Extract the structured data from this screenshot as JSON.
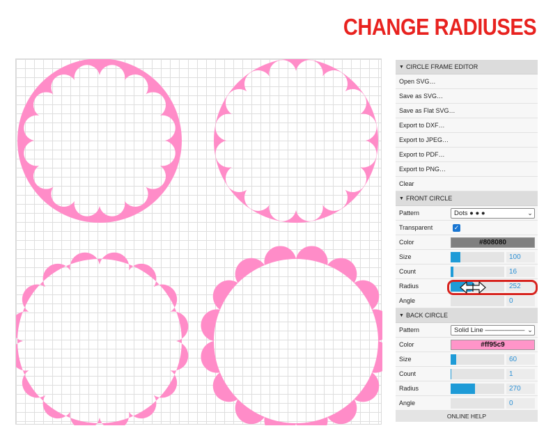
{
  "headline": "CHANGE RADIUSES",
  "editor": {
    "title": "CIRCLE FRAME EDITOR",
    "items": [
      "Open SVG…",
      "Save as SVG…",
      "Save as Flat SVG…",
      "Export to DXF…",
      "Export to JPEG…",
      "Export to PDF…",
      "Export to PNG…",
      "Clear"
    ]
  },
  "front": {
    "title": "FRONT CIRCLE",
    "pattern_label": "Pattern",
    "pattern_value": "Dots  ●  ●  ●",
    "transparent_label": "Transparent",
    "transparent_checked": true,
    "color_label": "Color",
    "color_value": "#808080",
    "size_label": "Size",
    "size_value": "100",
    "size_fill": 0.18,
    "count_label": "Count",
    "count_value": "16",
    "count_fill": 0.05,
    "radius_label": "Radius",
    "radius_value": "252",
    "radius_fill": 0.45,
    "angle_label": "Angle",
    "angle_value": "0",
    "angle_fill": 0
  },
  "back": {
    "title": "BACK CIRCLE",
    "pattern_label": "Pattern",
    "pattern_value": "Solid Line  ——————",
    "color_label": "Color",
    "color_value": "#ff95c9",
    "size_label": "Size",
    "size_value": "60",
    "size_fill": 0.11,
    "count_label": "Count",
    "count_value": "1",
    "count_fill": 0.01,
    "radius_label": "Radius",
    "radius_value": "270",
    "radius_fill": 0.46,
    "angle_label": "Angle",
    "angle_value": "0",
    "angle_fill": 0
  },
  "help_label": "ONLINE HELP",
  "colors": {
    "frame": "#ff8cc8",
    "accent": "#1e9bd7",
    "headline": "#e8221f",
    "highlight": "#d7231e"
  },
  "icons": [
    "chevron-down-icon",
    "check-icon",
    "resize-cursor-icon"
  ]
}
